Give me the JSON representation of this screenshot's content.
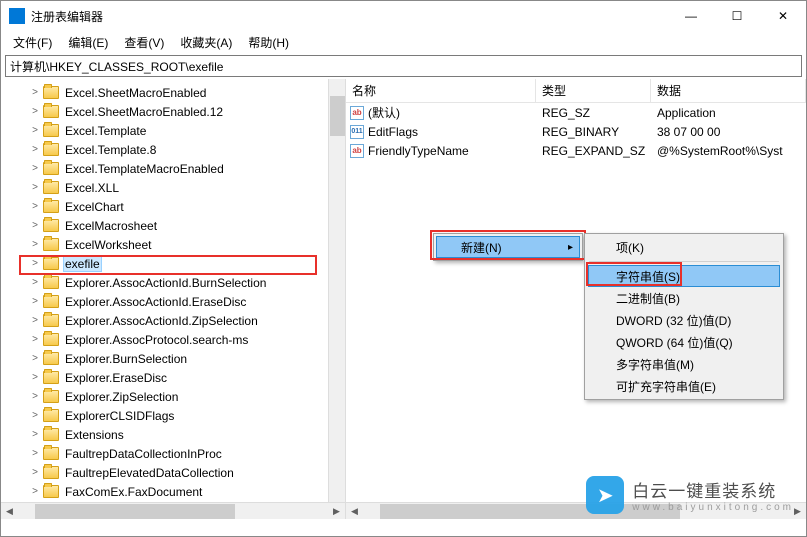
{
  "window": {
    "title": "注册表编辑器"
  },
  "winctrl": {
    "min": "—",
    "max": "☐",
    "close": "✕"
  },
  "menu": {
    "file": "文件(F)",
    "edit": "编辑(E)",
    "view": "查看(V)",
    "fav": "收藏夹(A)",
    "help": "帮助(H)"
  },
  "address": "计算机\\HKEY_CLASSES_ROOT\\exefile",
  "tree": [
    {
      "label": "Excel.SheetMacroEnabled",
      "exp": ">"
    },
    {
      "label": "Excel.SheetMacroEnabled.12",
      "exp": ">"
    },
    {
      "label": "Excel.Template",
      "exp": ">"
    },
    {
      "label": "Excel.Template.8",
      "exp": ">"
    },
    {
      "label": "Excel.TemplateMacroEnabled",
      "exp": ">"
    },
    {
      "label": "Excel.XLL",
      "exp": ">"
    },
    {
      "label": "ExcelChart",
      "exp": ">"
    },
    {
      "label": "ExcelMacrosheet",
      "exp": ">"
    },
    {
      "label": "ExcelWorksheet",
      "exp": ">"
    },
    {
      "label": "exefile",
      "exp": ">",
      "selected": true
    },
    {
      "label": "Explorer.AssocActionId.BurnSelection",
      "exp": ">"
    },
    {
      "label": "Explorer.AssocActionId.EraseDisc",
      "exp": ">"
    },
    {
      "label": "Explorer.AssocActionId.ZipSelection",
      "exp": ">"
    },
    {
      "label": "Explorer.AssocProtocol.search-ms",
      "exp": ">"
    },
    {
      "label": "Explorer.BurnSelection",
      "exp": ">"
    },
    {
      "label": "Explorer.EraseDisc",
      "exp": ">"
    },
    {
      "label": "Explorer.ZipSelection",
      "exp": ">"
    },
    {
      "label": "ExplorerCLSIDFlags",
      "exp": ">"
    },
    {
      "label": "Extensions",
      "exp": ">"
    },
    {
      "label": "FaultrepDataCollectionInProc",
      "exp": ">"
    },
    {
      "label": "FaultrepElevatedDataCollection",
      "exp": ">"
    },
    {
      "label": "FaxComEx.FaxDocument",
      "exp": ">"
    }
  ],
  "list": {
    "headers": {
      "name": "名称",
      "type": "类型",
      "data": "数据"
    },
    "rows": [
      {
        "icon": "str",
        "name": "(默认)",
        "type": "REG_SZ",
        "data": "Application"
      },
      {
        "icon": "bin",
        "name": "EditFlags",
        "type": "REG_BINARY",
        "data": "38 07 00 00"
      },
      {
        "icon": "str",
        "name": "FriendlyTypeName",
        "type": "REG_EXPAND_SZ",
        "data": "@%SystemRoot%\\Syst"
      }
    ]
  },
  "ctx": {
    "new": "新建(N)",
    "items": [
      "项(K)",
      "字符串值(S)",
      "二进制值(B)",
      "DWORD (32 位)值(D)",
      "QWORD (64 位)值(Q)",
      "多字符串值(M)",
      "可扩充字符串值(E)"
    ]
  },
  "watermark": {
    "line1": "白云一键重装系统",
    "line2": "www.baiyunxitong.com",
    "glyph": "➤"
  }
}
